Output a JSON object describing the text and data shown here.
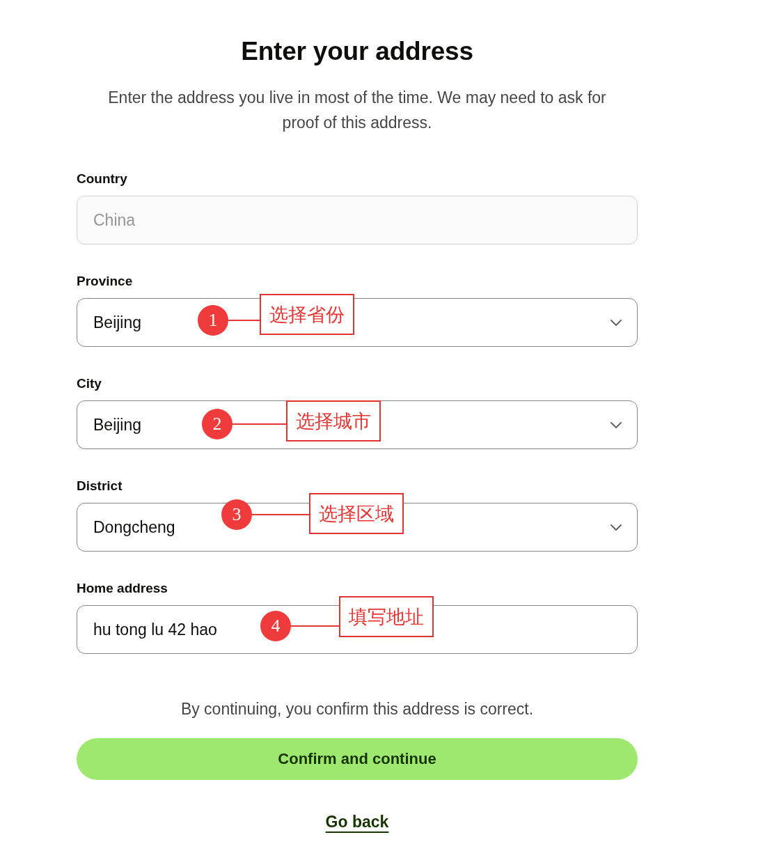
{
  "page": {
    "title": "Enter your address",
    "subtitle": "Enter the address you live in most of the time. We may need to ask for proof of this address."
  },
  "fields": [
    {
      "label": "Country",
      "kind": "text",
      "value": "China",
      "disabled": true
    },
    {
      "label": "Province",
      "kind": "select",
      "value": "Beijing",
      "disabled": false,
      "annotation": {
        "number": "1",
        "note": "选择省份"
      }
    },
    {
      "label": "City",
      "kind": "select",
      "value": "Beijing",
      "disabled": false,
      "annotation": {
        "number": "2",
        "note": "选择城市"
      }
    },
    {
      "label": "District",
      "kind": "select",
      "value": "Dongcheng",
      "disabled": false,
      "annotation": {
        "number": "3",
        "note": "选择区域"
      }
    },
    {
      "label": "Home address",
      "kind": "text",
      "value": "hu tong lu 42 hao",
      "disabled": false,
      "annotation": {
        "number": "4",
        "note": "填写地址"
      }
    }
  ],
  "footer": {
    "notice": "By continuing, you confirm this address is correct.",
    "primary_button": "Confirm and continue",
    "link": "Go back"
  }
}
